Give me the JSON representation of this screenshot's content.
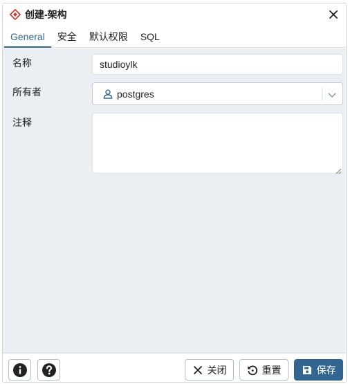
{
  "dialog": {
    "title": "创建-架构",
    "title_icon": "schema-diamond-icon",
    "close_icon": "close-icon"
  },
  "tabs": [
    {
      "label": "General",
      "active": true
    },
    {
      "label": "安全",
      "active": false
    },
    {
      "label": "默认权限",
      "active": false
    },
    {
      "label": "SQL",
      "active": false
    }
  ],
  "form": {
    "name_label": "名称",
    "name_value": "studioylk",
    "owner_label": "所有者",
    "owner_value": "postgres",
    "comment_label": "注释",
    "comment_value": ""
  },
  "footer": {
    "info_icon": "info-icon",
    "help_icon": "help-icon",
    "close_label": "关闭",
    "reset_label": "重置",
    "save_label": "保存"
  },
  "colors": {
    "accent": "#326690",
    "brand_red": "#c8312c",
    "body_bg": "#ebeef3"
  }
}
